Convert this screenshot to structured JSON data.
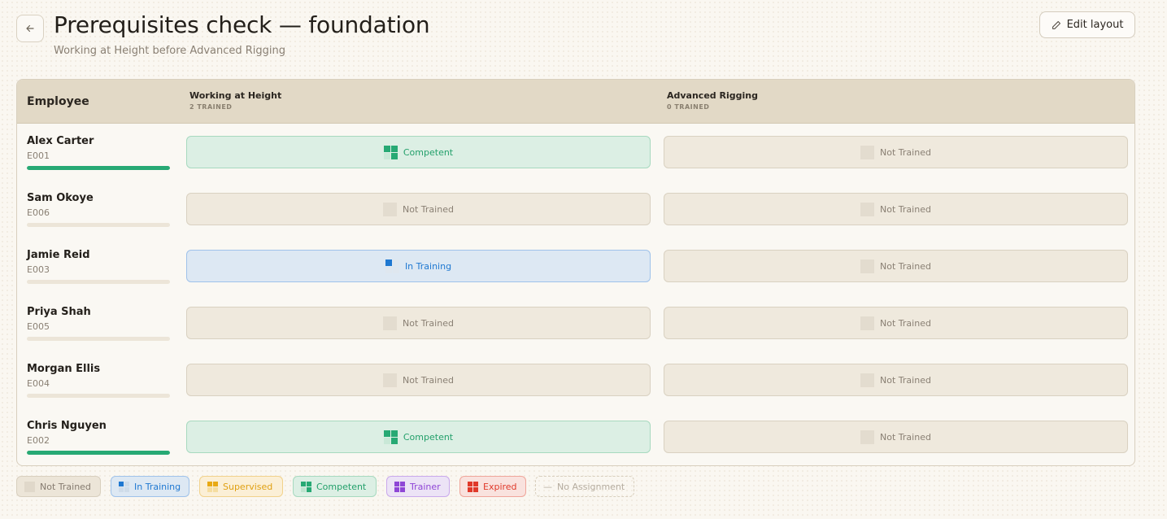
{
  "header": {
    "back_icon": "arrow-left-icon",
    "title": "Prerequisites check — foundation",
    "subtitle": "Working at Height before Advanced Rigging",
    "edit_icon": "pencil-icon",
    "edit_label": "Edit layout"
  },
  "table": {
    "employee_header": "Employee",
    "skills": [
      {
        "name": "Working at Height",
        "count": "2 TRAINED"
      },
      {
        "name": "Advanced Rigging",
        "count": "0 TRAINED"
      }
    ],
    "rows": [
      {
        "name": "Alex Carter",
        "id": "E001",
        "progress": 1.0,
        "cells": [
          {
            "status": "Competent",
            "kind": "comp"
          },
          {
            "status": "Not Trained",
            "kind": "not"
          }
        ]
      },
      {
        "name": "Sam Okoye",
        "id": "E006",
        "progress": 0.0,
        "cells": [
          {
            "status": "Not Trained",
            "kind": "not"
          },
          {
            "status": "Not Trained",
            "kind": "not"
          }
        ]
      },
      {
        "name": "Jamie Reid",
        "id": "E003",
        "progress": 0.0,
        "cells": [
          {
            "status": "In Training",
            "kind": "train"
          },
          {
            "status": "Not Trained",
            "kind": "not"
          }
        ]
      },
      {
        "name": "Priya Shah",
        "id": "E005",
        "progress": 0.0,
        "cells": [
          {
            "status": "Not Trained",
            "kind": "not"
          },
          {
            "status": "Not Trained",
            "kind": "not"
          }
        ]
      },
      {
        "name": "Morgan Ellis",
        "id": "E004",
        "progress": 0.0,
        "cells": [
          {
            "status": "Not Trained",
            "kind": "not"
          },
          {
            "status": "Not Trained",
            "kind": "not"
          }
        ]
      },
      {
        "name": "Chris Nguyen",
        "id": "E002",
        "progress": 1.0,
        "cells": [
          {
            "status": "Competent",
            "kind": "comp"
          },
          {
            "status": "Not Trained",
            "kind": "not"
          }
        ]
      }
    ]
  },
  "legend": {
    "not_trained": "Not Trained",
    "in_training": "In Training",
    "supervised": "Supervised",
    "competent": "Competent",
    "trainer": "Trainer",
    "expired": "Expired",
    "no_assignment": "No Assignment",
    "no_assignment_glyph": "—"
  },
  "colors": {
    "competent": "#27a974",
    "in_training": "#1f78d1",
    "supervised": "#e0a012",
    "trainer": "#8f46d6",
    "expired": "#e0392a",
    "not_trained": "#e3dccf"
  }
}
